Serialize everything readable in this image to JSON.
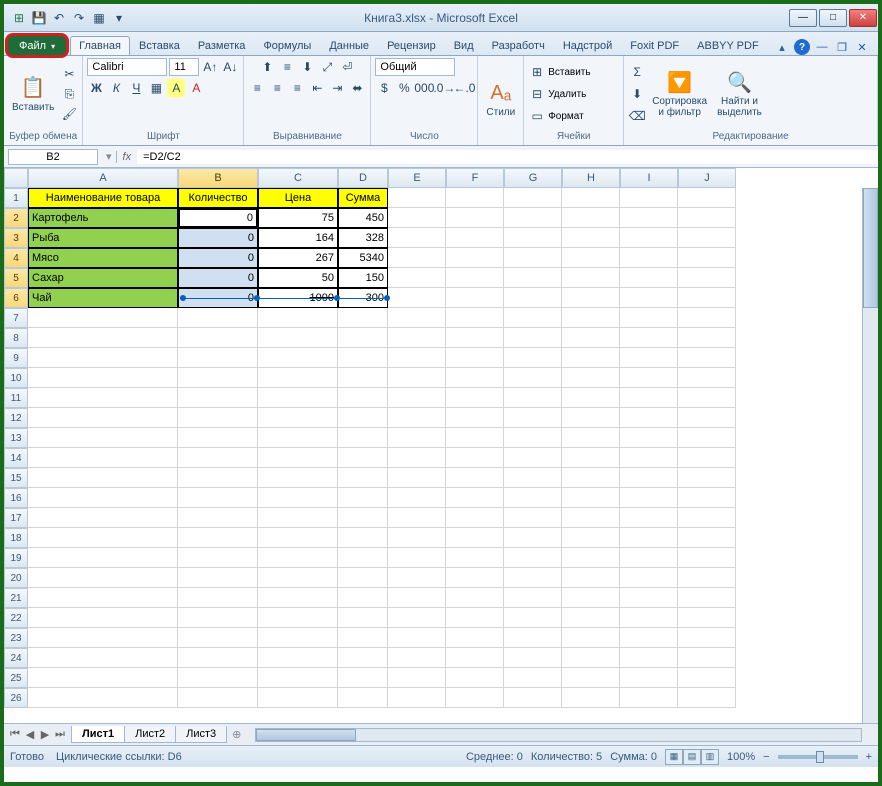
{
  "title": "Книга3.xlsx - Microsoft Excel",
  "tabs": {
    "file": "Файл",
    "list": [
      "Главная",
      "Вставка",
      "Разметка",
      "Формулы",
      "Данные",
      "Рецензир",
      "Вид",
      "Разработч",
      "Надстрой",
      "Foxit PDF",
      "ABBYY PDF"
    ]
  },
  "ribbon": {
    "clipboard": {
      "paste": "Вставить",
      "label": "Буфер обмена"
    },
    "font": {
      "name": "Calibri",
      "size": "11",
      "label": "Шрифт"
    },
    "alignment": {
      "label": "Выравнивание"
    },
    "number": {
      "format": "Общий",
      "label": "Число"
    },
    "styles": {
      "btn": "Стили",
      "label": ""
    },
    "cells": {
      "insert": "Вставить",
      "delete": "Удалить",
      "format": "Формат",
      "label": "Ячейки"
    },
    "editing": {
      "sort": "Сортировка\nи фильтр",
      "find": "Найти и\nвыделить",
      "label": "Редактирование"
    }
  },
  "nameBox": "B2",
  "formula": "=D2/C2",
  "columns": [
    "A",
    "B",
    "C",
    "D",
    "E",
    "F",
    "G",
    "H",
    "I",
    "J"
  ],
  "headers": [
    "Наименование товара",
    "Количество",
    "Цена",
    "Сумма"
  ],
  "rows": [
    {
      "name": "Картофель",
      "qty": "0",
      "price": "75",
      "sum": "450"
    },
    {
      "name": "Рыба",
      "qty": "0",
      "price": "164",
      "sum": "328"
    },
    {
      "name": "Мясо",
      "qty": "0",
      "price": "267",
      "sum": "5340"
    },
    {
      "name": "Сахар",
      "qty": "0",
      "price": "50",
      "sum": "150"
    },
    {
      "name": "Чай",
      "qty": "0",
      "price": "1000",
      "sum": "300"
    }
  ],
  "sheets": [
    "Лист1",
    "Лист2",
    "Лист3"
  ],
  "status": {
    "ready": "Готово",
    "circ": "Циклические ссылки: D6",
    "avg": "Среднее: 0",
    "count": "Количество: 5",
    "sum": "Сумма: 0",
    "zoom": "100%"
  }
}
